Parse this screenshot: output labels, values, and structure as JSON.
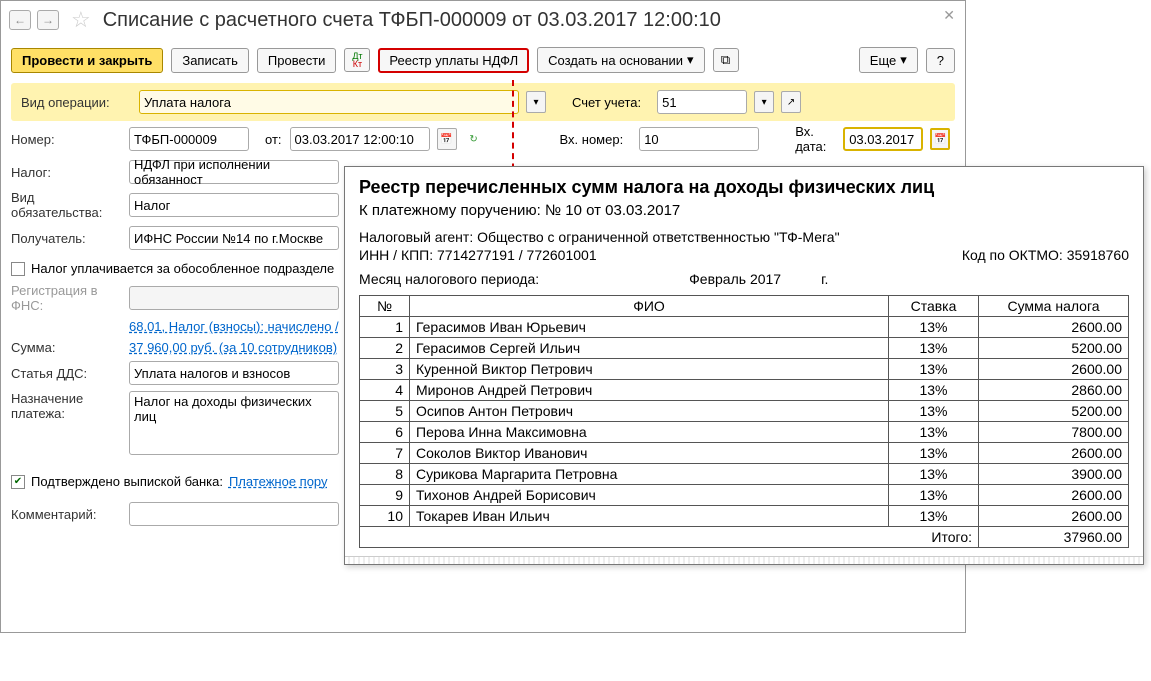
{
  "title": "Списание с расчетного счета ТФБП-000009 от 03.03.2017 12:00:10",
  "toolbar": {
    "post_close": "Провести и закрыть",
    "save": "Записать",
    "post": "Провести",
    "registry": "Реестр уплаты НДФЛ",
    "create_on": "Создать на основании",
    "more": "Еще",
    "help": "?"
  },
  "labels": {
    "op_type": "Вид операции:",
    "number": "Номер:",
    "from": "от:",
    "in_no": "Вх. номер:",
    "in_date": "Вх. дата:",
    "account": "Счет учета:",
    "tax": "Налог:",
    "obl_type": "Вид обязательства:",
    "recipient": "Получатель:",
    "paid_subdiv": "Налог уплачивается за обособленное подразделе",
    "reg_fns": "Регистрация в ФНС:",
    "accrued_link": "68.01, Налог (взносы): начислено /",
    "sum": "Сумма:",
    "sum_link": "37 960,00 руб. (за 10 сотрудников)",
    "dds": "Статья ДДС:",
    "purpose": "Назначение платежа:",
    "confirmed": "Подтверждено выпиской банка:",
    "payment_order": "Платежное пору",
    "comment": "Комментарий:"
  },
  "values": {
    "op_type": "Уплата налога",
    "number": "ТФБП-000009",
    "date": "03.03.2017 12:00:10",
    "in_no": "10",
    "in_date": "03.03.2017",
    "account": "51",
    "tax": "НДФЛ при исполнении обязанност",
    "obl_type": "Налог",
    "recipient": "ИФНС России №14 по г.Москве",
    "dds": "Уплата налогов и взносов",
    "purpose": "Налог на доходы физических лиц"
  },
  "report": {
    "title": "Реестр перечисленных сумм налога на доходы физических лиц",
    "sub": "К платежному поручению: № 10 от 03.03.2017",
    "agent": "Налоговый агент: Общество с ограниченной ответственностью \"ТФ-Мега\"",
    "inn_kpp": "ИНН / КПП: 7714277191 / 772601001",
    "oktmo": "Код по ОКТМО: 35918760",
    "period_lbl": "Месяц налогового периода:",
    "period_val": "Февраль 2017",
    "period_g": "г.",
    "headers": {
      "no": "№",
      "fio": "ФИО",
      "rate": "Ставка",
      "tax_sum": "Сумма налога"
    },
    "rows": [
      {
        "n": 1,
        "fio": "Герасимов Иван Юрьевич",
        "rate": "13%",
        "sum": "2600.00"
      },
      {
        "n": 2,
        "fio": "Герасимов Сергей Ильич",
        "rate": "13%",
        "sum": "5200.00"
      },
      {
        "n": 3,
        "fio": "Куренной Виктор Петрович",
        "rate": "13%",
        "sum": "2600.00"
      },
      {
        "n": 4,
        "fio": "Миронов Андрей Петрович",
        "rate": "13%",
        "sum": "2860.00"
      },
      {
        "n": 5,
        "fio": "Осипов Антон Петрович",
        "rate": "13%",
        "sum": "5200.00"
      },
      {
        "n": 6,
        "fio": "Перова Инна Максимовна",
        "rate": "13%",
        "sum": "7800.00"
      },
      {
        "n": 7,
        "fio": "Соколов Виктор Иванович",
        "rate": "13%",
        "sum": "2600.00"
      },
      {
        "n": 8,
        "fio": "Сурикова Маргарита Петровна",
        "rate": "13%",
        "sum": "3900.00"
      },
      {
        "n": 9,
        "fio": "Тихонов Андрей Борисович",
        "rate": "13%",
        "sum": "2600.00"
      },
      {
        "n": 10,
        "fio": "Токарев Иван Ильич",
        "rate": "13%",
        "sum": "2600.00"
      }
    ],
    "total_lbl": "Итого:",
    "total": "37960.00"
  }
}
